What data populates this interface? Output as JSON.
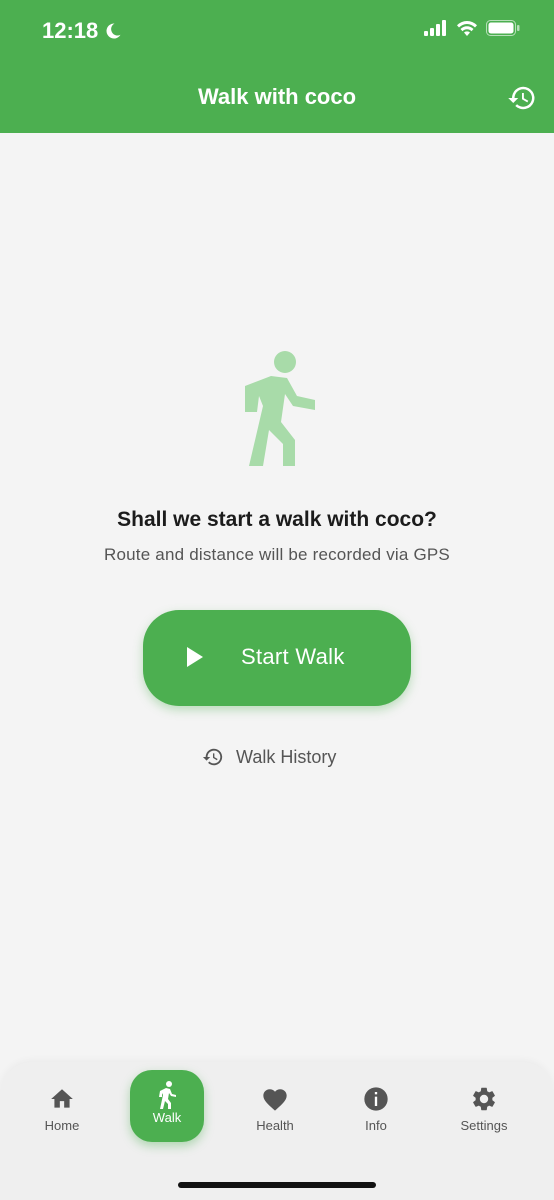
{
  "status_bar": {
    "time": "12:18"
  },
  "header": {
    "title": "Walk with coco"
  },
  "main": {
    "prompt": "Shall we start a walk with coco?",
    "subtitle": "Route and distance will be recorded via GPS",
    "start_button_label": "Start Walk",
    "history_link_label": "Walk History"
  },
  "bottom_nav": {
    "items": [
      {
        "label": "Home",
        "icon": "home-icon"
      },
      {
        "label": "Walk",
        "icon": "walk-icon",
        "active": true
      },
      {
        "label": "Health",
        "icon": "heart-icon"
      },
      {
        "label": "Info",
        "icon": "info-icon"
      },
      {
        "label": "Settings",
        "icon": "gear-icon"
      }
    ]
  },
  "colors": {
    "accent": "#4caf50",
    "illustration": "#a8dba9",
    "background": "#f4f4f4"
  }
}
